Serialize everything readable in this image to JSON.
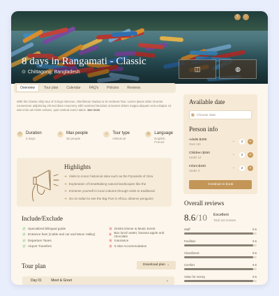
{
  "hero": {
    "title": "8 days in Rangamati - Classic",
    "location": "Chittagong, Bangladesh",
    "share_icon": "share-icon",
    "heart_icon": "heart-icon",
    "thumbs": [
      {
        "icon": "camera-icon",
        "glyph": "◫"
      },
      {
        "icon": "globe-icon",
        "glyph": "◍"
      }
    ]
  },
  "tabs": [
    "Overview",
    "Tour plan",
    "Calendar",
    "FAQ's",
    "Policies",
    "Reviews"
  ],
  "overview": {
    "lead": "With the Classic Ship tour of 3 Days Glencoe, Glenfinnan Viaduct & St Andrews Tour.",
    "body": "Lorem ipsum dolor sit amet consectetur adipisicing elit sed diam nonummy nibh euismod tincidunt ut laoreet dolore magna aliquam erat volutpat. Ut wisi enim ad minim veniam, quis nostrud exerci tation.",
    "see_more": "See more"
  },
  "facts": [
    {
      "icon": "clock-icon",
      "glyph": "◷",
      "title": "Duration",
      "value": "4 days"
    },
    {
      "icon": "users-icon",
      "glyph": "☺",
      "title": "Max people",
      "value": "30 people"
    },
    {
      "icon": "tag-icon",
      "glyph": "⌂",
      "title": "Tour type",
      "value": "Historical"
    },
    {
      "icon": "language-icon",
      "glyph": "◎",
      "title": "Language",
      "value": "English, France"
    }
  ],
  "highlights": {
    "title": "Highlights",
    "items": [
      "Visits to iconic historical sites such as the Pyramids of Giza",
      "Exploration of breathtaking natural landscapes like the",
      "Immerse yourself in local cultures through visits to traditional",
      "Go on safari to see the Big Five in Africa, observe penguins"
    ]
  },
  "include": {
    "title": "Include/Exclude",
    "included": [
      "Specialized bilingual guide",
      "Entrance fees (Cable and car and Moon Valley)",
      "Departure Taxes",
      "Airport Transfers"
    ],
    "excluded": [
      "Drinks Dinner & Music Event",
      "Box lunch water, banana apple and chocolate",
      "Insurance",
      "5 Star Accommodation"
    ]
  },
  "tour_plan": {
    "title": "Tour plan",
    "download": "Download plan",
    "days": [
      {
        "day": "Day 01",
        "name": "Meet & Greet"
      }
    ]
  },
  "booking": {
    "date_title": "Available date",
    "date_placeholder": "Choose date",
    "person_title": "Person info",
    "people": [
      {
        "label": "Adults $400",
        "note": "Over 18+",
        "count": "2"
      },
      {
        "label": "Children $250",
        "note": "Under 12",
        "count": "2"
      },
      {
        "label": "Infant $100",
        "note": "Under 3",
        "count": "2"
      }
    ],
    "cta": "Continue to book"
  },
  "reviews": {
    "title": "Overall reviews",
    "score": "8.6",
    "out_of": "/10",
    "rating_label": "Excellent",
    "total": "Total 110 reviews",
    "bars": [
      {
        "name": "Staff",
        "value": "9.5",
        "pct": 0.95
      },
      {
        "name": "Facilities",
        "value": "9.5",
        "pct": 0.95
      },
      {
        "name": "Cleanliness",
        "value": "9.5",
        "pct": 0.95
      },
      {
        "name": "Comfort",
        "value": "9.5",
        "pct": 0.95
      },
      {
        "name": "Value for money",
        "value": "9.5",
        "pct": 0.95
      }
    ]
  },
  "colors": {
    "accent": "#c39658",
    "bg": "#fcf6ec",
    "panel": "#f6ead6"
  }
}
